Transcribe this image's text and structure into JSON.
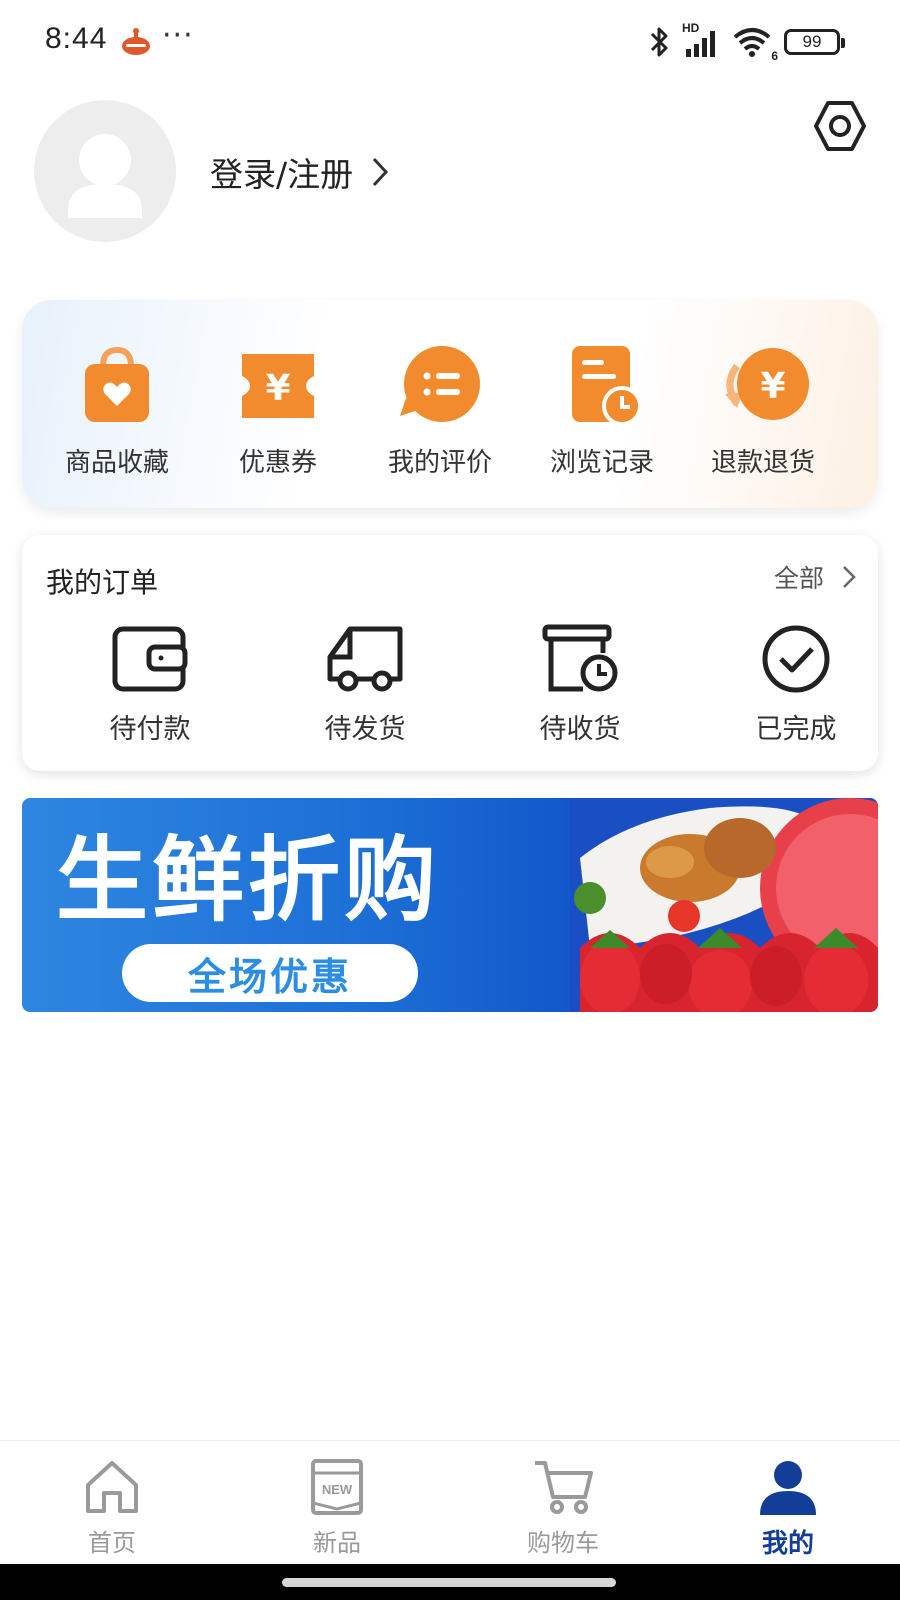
{
  "status_bar": {
    "time": "8:44",
    "more": "···",
    "battery_level": "99",
    "network_label": "HD",
    "wifi_badge": "6"
  },
  "profile": {
    "login_label": "登录/注册"
  },
  "quick_actions": [
    {
      "label": "商品收藏",
      "icon": "favorites-bag-icon"
    },
    {
      "label": "优惠券",
      "icon": "coupon-ticket-icon"
    },
    {
      "label": "我的评价",
      "icon": "review-bubble-icon"
    },
    {
      "label": "浏览记录",
      "icon": "history-doc-icon"
    },
    {
      "label": "退款退货",
      "icon": "refund-coin-icon"
    }
  ],
  "orders": {
    "title": "我的订单",
    "all_label": "全部",
    "items": [
      {
        "label": "待付款",
        "icon": "wallet-icon"
      },
      {
        "label": "待发货",
        "icon": "truck-icon"
      },
      {
        "label": "待收货",
        "icon": "box-clock-icon"
      },
      {
        "label": "已完成",
        "icon": "check-circle-icon"
      }
    ]
  },
  "banner": {
    "title": "生鲜折购",
    "button": "全场优惠"
  },
  "bottom_nav": {
    "active_index": 3,
    "items": [
      {
        "label": "首页",
        "icon": "home-icon"
      },
      {
        "label": "新品",
        "icon": "new-icon",
        "badge": "NEW"
      },
      {
        "label": "购物车",
        "icon": "cart-icon"
      },
      {
        "label": "我的",
        "icon": "user-icon"
      }
    ]
  },
  "colors": {
    "accent_orange": "#f28a2e",
    "nav_active": "#123e97",
    "banner_blue": "#1c6fd6"
  }
}
